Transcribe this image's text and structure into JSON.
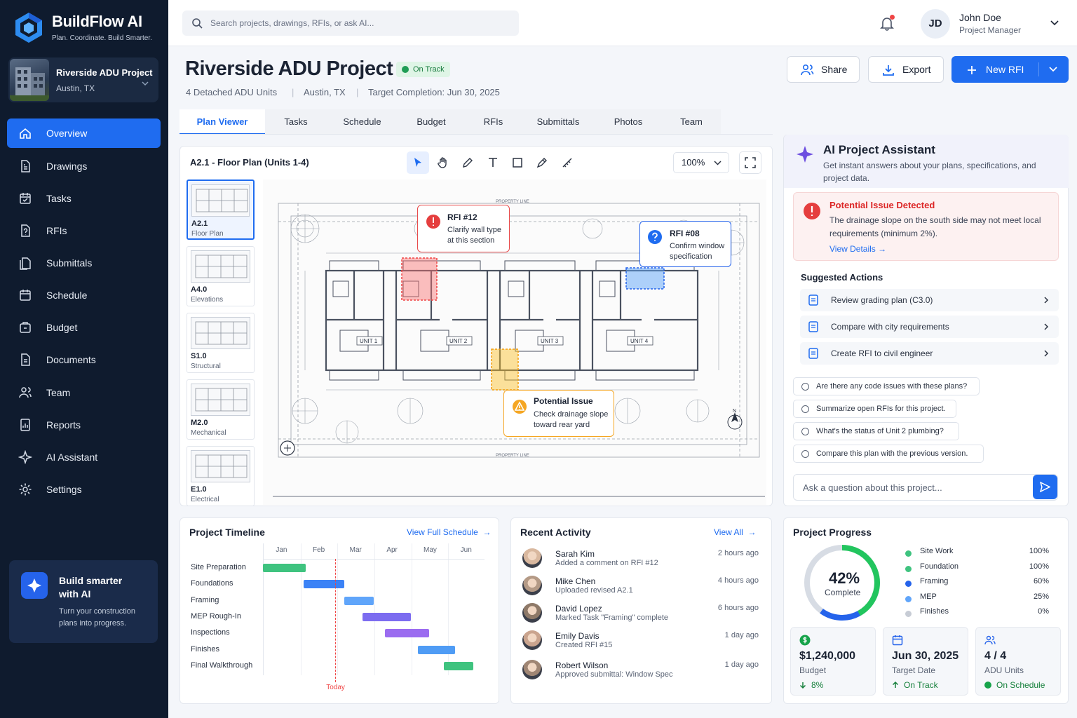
{
  "brand": {
    "name": "BuildFlow AI",
    "tagline": "Plan. Coordinate. Build Smarter."
  },
  "project_card": {
    "name": "Riverside ADU Project",
    "location": "Austin, TX"
  },
  "nav": [
    {
      "label": "Overview",
      "icon": "home-icon",
      "active": true
    },
    {
      "label": "Drawings",
      "icon": "drawing-icon"
    },
    {
      "label": "Tasks",
      "icon": "calendar-check-icon"
    },
    {
      "label": "RFIs",
      "icon": "document-question-icon"
    },
    {
      "label": "Submittals",
      "icon": "document-stack-icon"
    },
    {
      "label": "Schedule",
      "icon": "calendar-icon"
    },
    {
      "label": "Budget",
      "icon": "wallet-icon"
    },
    {
      "label": "Documents",
      "icon": "document-icon"
    },
    {
      "label": "Team",
      "icon": "people-icon"
    },
    {
      "label": "Reports",
      "icon": "report-icon"
    },
    {
      "label": "AI Assistant",
      "icon": "sparkle-icon"
    },
    {
      "label": "Settings",
      "icon": "gear-icon"
    }
  ],
  "promo": {
    "title": "Build smarter with AI",
    "text": "Turn your construction plans into progress."
  },
  "search": {
    "placeholder": "Search projects, drawings, RFIs, or ask AI..."
  },
  "user": {
    "initials": "JD",
    "name": "John Doe",
    "role": "Project Manager"
  },
  "header": {
    "title": "Riverside ADU Project",
    "status": "On Track",
    "units": "4 Detached ADU Units",
    "location": "Austin, TX",
    "target": "Target Completion: Jun 30, 2025",
    "share": "Share",
    "export": "Export",
    "new_rfi": "New RFI"
  },
  "tabs": [
    "Plan Viewer",
    "Tasks",
    "Schedule",
    "Budget",
    "RFIs",
    "Submittals",
    "Photos",
    "Team"
  ],
  "viewer": {
    "title": "A2.1 - Floor Plan (Units 1-4)",
    "zoom": "100%",
    "sheets": [
      {
        "code": "A2.1",
        "name": "Floor Plan",
        "active": true
      },
      {
        "code": "A4.0",
        "name": "Elevations"
      },
      {
        "code": "S1.0",
        "name": "Structural"
      },
      {
        "code": "M2.0",
        "name": "Mechanical"
      },
      {
        "code": "E1.0",
        "name": "Electrical"
      }
    ],
    "units": [
      "UNIT 1",
      "UNIT 2",
      "UNIT 3",
      "UNIT 4"
    ],
    "property_line": "PROPERTY LINE",
    "north": "N",
    "callouts": {
      "rfi12": {
        "title": "RFI #12",
        "line1": "Clarify wall type",
        "line2": "at this section"
      },
      "rfi08": {
        "title": "RFI #08",
        "line1": "Confirm window",
        "line2": "specification"
      },
      "issue": {
        "title": "Potential Issue",
        "line1": "Check drainage slope",
        "line2": "toward rear yard"
      }
    }
  },
  "ai": {
    "title": "AI Project Assistant",
    "desc": "Get instant answers about your plans, specifications, and project data.",
    "issue": {
      "title": "Potential Issue Detected",
      "body": "The drainage slope on the south side may not meet local requirements (minimum 2%).",
      "link": "View Details"
    },
    "suggested_title": "Suggested Actions",
    "actions": [
      "Review grading plan (C3.0)",
      "Compare with city requirements",
      "Create RFI to civil engineer"
    ],
    "prompts": [
      "Are there any code issues with these plans?",
      "Summarize open RFIs for this project.",
      "What's the status of Unit 2 plumbing?",
      "Compare this plan with the previous version."
    ],
    "ask_placeholder": "Ask a question about this project..."
  },
  "timeline": {
    "title": "Project Timeline",
    "link": "View Full Schedule",
    "months": [
      "Jan",
      "Feb",
      "Mar",
      "Apr",
      "May",
      "Jun"
    ],
    "today_label": "Today",
    "today_month": 2.0,
    "tasks": [
      {
        "name": "Site Preparation",
        "start": 0,
        "end": 1.15,
        "color": "#3fc37f"
      },
      {
        "name": "Foundations",
        "start": 1.1,
        "end": 2.2,
        "color": "#3b82f6"
      },
      {
        "name": "Framing",
        "start": 2.2,
        "end": 3.0,
        "color": "#60a5fa"
      },
      {
        "name": "MEP Rough-In",
        "start": 2.7,
        "end": 4.0,
        "color": "#7c6cf0"
      },
      {
        "name": "Inspections",
        "start": 3.3,
        "end": 4.5,
        "color": "#9b6cf0"
      },
      {
        "name": "Finishes",
        "start": 4.2,
        "end": 5.2,
        "color": "#4f9cf5"
      },
      {
        "name": "Final Walkthrough",
        "start": 4.9,
        "end": 5.7,
        "color": "#3fc37f"
      }
    ]
  },
  "activity": {
    "title": "Recent Activity",
    "link": "View All",
    "items": [
      {
        "name": "Sarah Kim",
        "desc": "Added a comment on RFI #12",
        "time": "2 hours ago"
      },
      {
        "name": "Mike Chen",
        "desc": "Uploaded revised A2.1",
        "time": "4 hours ago"
      },
      {
        "name": "David Lopez",
        "desc": "Marked Task \"Framing\" complete",
        "time": "6 hours ago"
      },
      {
        "name": "Emily Davis",
        "desc": "Created RFI #15",
        "time": "1 day ago"
      },
      {
        "name": "Robert Wilson",
        "desc": "Approved submittal: Window Spec",
        "time": "1 day ago"
      }
    ]
  },
  "progress": {
    "title": "Project Progress",
    "percent_value": 42,
    "percent": "42%",
    "complete": "Complete",
    "items": [
      {
        "name": "Site Work",
        "value": "100%",
        "color": "#3fc37f"
      },
      {
        "name": "Foundation",
        "value": "100%",
        "color": "#3fc37f"
      },
      {
        "name": "Framing",
        "value": "60%",
        "color": "#2563eb"
      },
      {
        "name": "MEP",
        "value": "25%",
        "color": "#60a5fa"
      },
      {
        "name": "Finishes",
        "value": "0%",
        "color": "#c7ccd5"
      }
    ],
    "stats": [
      {
        "value": "$1,240,000",
        "label": "Budget",
        "sub": "8%",
        "icon": "dollar-icon",
        "color": "#16a34a"
      },
      {
        "value": "Jun 30, 2025",
        "label": "Target Date",
        "sub": "On Track",
        "icon": "calendar-icon",
        "color": "#2563eb"
      },
      {
        "value": "4 / 4",
        "label": "ADU Units",
        "sub": "On Schedule",
        "icon": "people-icon",
        "color": "#2563eb"
      }
    ]
  },
  "colors": {
    "accent": "#1f6cf0",
    "sidebar": "#0f1b2e",
    "danger": "#dc2626",
    "warning": "#f5a623",
    "success": "#16a34a"
  }
}
